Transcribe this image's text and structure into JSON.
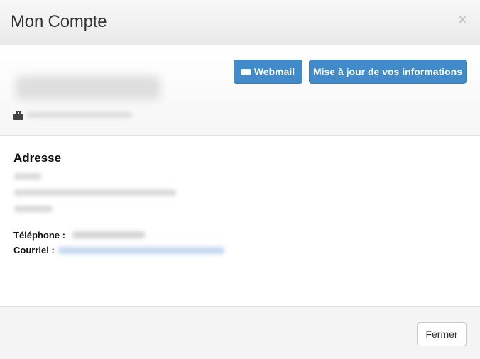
{
  "header": {
    "title": "Mon Compte",
    "close_symbol": "×"
  },
  "profile": {
    "actions": {
      "webmail_label": "Webmail",
      "update_label": "Mise à jour de vos informations"
    },
    "icons": {
      "role": "briefcase-icon",
      "webmail": "envelope-icon"
    }
  },
  "address": {
    "title": "Adresse"
  },
  "contact": {
    "phone_label": "Téléphone :",
    "email_label": "Courriel :"
  },
  "footer": {
    "close_label": "Fermer"
  },
  "colors": {
    "primary": "#428bca",
    "header_bg": "#eeeeee",
    "footer_bg": "#f4f4f4"
  }
}
